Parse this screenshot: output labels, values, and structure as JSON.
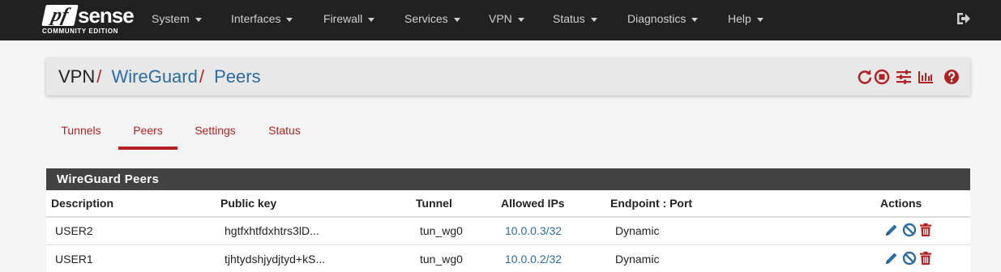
{
  "app": {
    "logo_main": "sense",
    "logo_pf": "pf",
    "logo_sub": "COMMUNITY EDITION"
  },
  "nav": {
    "items": [
      {
        "label": "System"
      },
      {
        "label": "Interfaces"
      },
      {
        "label": "Firewall"
      },
      {
        "label": "Services"
      },
      {
        "label": "VPN"
      },
      {
        "label": "Status"
      },
      {
        "label": "Diagnostics"
      },
      {
        "label": "Help"
      }
    ],
    "logout_icon": "sign-out-icon"
  },
  "breadcrumb": {
    "items": [
      {
        "label": "VPN"
      },
      {
        "label": "WireGuard"
      },
      {
        "label": "Peers"
      }
    ],
    "separator": "/",
    "icons": [
      "restart-icon",
      "stop-icon",
      "sliders-icon",
      "bar-chart-icon",
      "help-icon"
    ]
  },
  "tabs": [
    {
      "label": "Tunnels",
      "active": false
    },
    {
      "label": "Peers",
      "active": true
    },
    {
      "label": "Settings",
      "active": false
    },
    {
      "label": "Status",
      "active": false
    }
  ],
  "panel": {
    "title": "WireGuard Peers",
    "columns": [
      "Description",
      "Public key",
      "Tunnel",
      "Allowed IPs",
      "Endpoint : Port",
      "Actions"
    ],
    "rows": [
      {
        "description": "USER2",
        "public_key": "hgtfxhtfdxhtrs3lD...",
        "tunnel": "tun_wg0",
        "allowed_ips": "10.0.0.3/32",
        "endpoint": "Dynamic"
      },
      {
        "description": "USER1",
        "public_key": "tjhtydshjydjtyd+kS...",
        "tunnel": "tun_wg0",
        "allowed_ips": "10.0.0.2/32",
        "endpoint": "Dynamic"
      }
    ],
    "row_actions": [
      "edit-icon",
      "disable-icon",
      "delete-icon"
    ]
  },
  "colors": {
    "navbar": "#212121",
    "accent_red": "#b22222",
    "link_blue": "#2d6ca2",
    "panel_heading": "#424242"
  }
}
